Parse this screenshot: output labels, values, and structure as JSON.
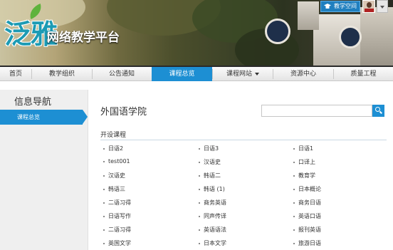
{
  "header": {
    "logo_text": "泛雅",
    "platform_title": "网络教学平台",
    "space_button": "教学空间"
  },
  "nav": {
    "items": [
      {
        "label": "首页"
      },
      {
        "label": "教学组织"
      },
      {
        "label": "公告通知"
      },
      {
        "label": "课程总览",
        "active": true
      },
      {
        "label": "课程网站",
        "dropdown": true
      },
      {
        "label": "资源中心"
      },
      {
        "label": "质量工程"
      }
    ]
  },
  "sidebar": {
    "title": "信息导航",
    "items": [
      {
        "label": "课程总览",
        "active": true
      }
    ]
  },
  "main": {
    "college_title": "外国语学院",
    "search_placeholder": "",
    "section_title": "开设课程",
    "courses": [
      [
        "日语2",
        "日语3",
        "日语1"
      ],
      [
        "test001",
        "汉语史",
        "口译上"
      ],
      [
        "汉语史",
        "韩语二",
        "教育学"
      ],
      [
        "韩语三",
        "韩语 (1)",
        "日本概论"
      ],
      [
        "二语习得",
        "商务英语",
        "商务日语"
      ],
      [
        "日语写作",
        "同声传译",
        "英语口语"
      ],
      [
        "二语习得",
        "英语语法",
        "报刊英语"
      ],
      [
        "英国文学",
        "日本文学",
        "旅游日语"
      ]
    ]
  },
  "colors": {
    "accent": "#1d8fd3",
    "nav_bar_top": "#2a2a2a",
    "sidebar_bg": "#efefef",
    "logo": "#1c9bb4"
  },
  "icons": {
    "search": "search-icon",
    "space": "graduation-cap-icon",
    "dropdown": "chevron-down-icon"
  }
}
